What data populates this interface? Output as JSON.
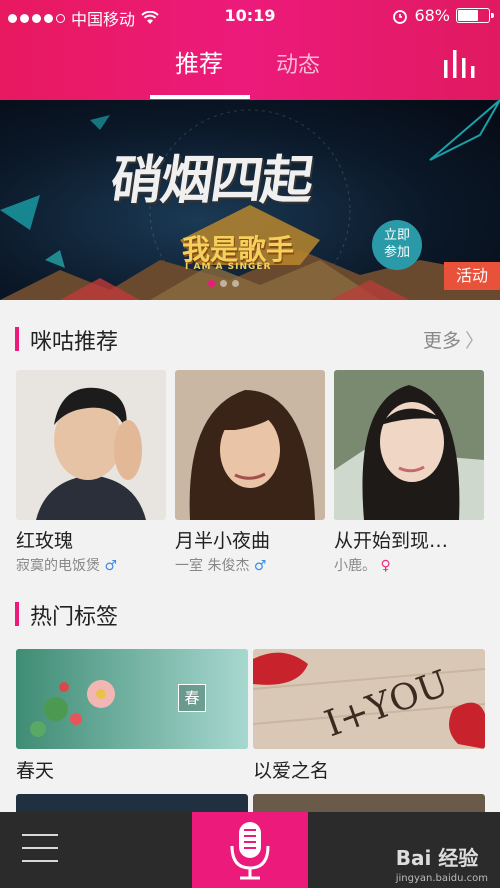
{
  "status_bar": {
    "carrier": "中国移动",
    "time": "10:19",
    "battery": "68%",
    "battery_level": 0.68
  },
  "header": {
    "tabs": [
      {
        "label": "推荐",
        "active": true
      },
      {
        "label": "动态",
        "active": false
      }
    ]
  },
  "banner": {
    "title": "硝烟四起",
    "logo": "我是歌手",
    "logo_sub": "I AM A SINGER",
    "join_line1": "立即",
    "join_line2": "参加",
    "tag": "活动"
  },
  "recommend": {
    "title": "咪咕推荐",
    "more": "更多",
    "items": [
      {
        "name": "红玫瑰",
        "user": "寂寞的电饭煲",
        "gender": "♂"
      },
      {
        "name": "月半小夜曲",
        "user": "一室 朱俊杰",
        "gender": "♂"
      },
      {
        "name": "从开始到现…",
        "user": "小鹿。",
        "gender": "♀"
      }
    ]
  },
  "hot_tags": {
    "title": "热门标签",
    "items": [
      {
        "label": "春天",
        "badge": "春"
      },
      {
        "label": "以爱之名"
      }
    ]
  },
  "watermark": {
    "brand": "Bai 经验",
    "url": "jingyan.baidu.com"
  },
  "colors": {
    "accent": "#ec1a7a",
    "male": "#3a8ee6",
    "female": "#e6337e",
    "bottom_bar": "#2b2b2b"
  }
}
